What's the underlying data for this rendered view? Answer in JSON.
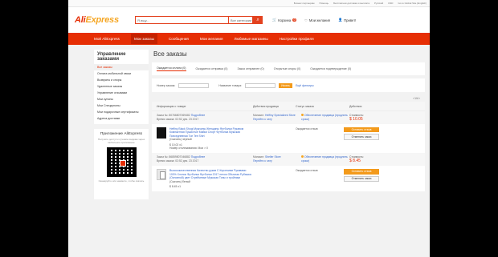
{
  "topbar": {
    "links": [
      "Бизнес партнерам",
      "Помощь",
      "Сохранить",
      "Бесплатная доставка и выплата",
      "Русский",
      "USD",
      "Sell on AliExpress",
      "Go to Global Site (English)"
    ]
  },
  "header": {
    "logo_main": "Ali",
    "logo_sub": "Express",
    "search_placeholder": "Я ищу...",
    "search_category": "Все категории",
    "cart_label": "Корзина",
    "cart_count": "0",
    "wishlist_label": "Мои желания",
    "account_label": "Привет!"
  },
  "nav": {
    "items": [
      "Мой AliExpress",
      "Мои заказы",
      "Сообщения",
      "Мои желания",
      "Любимые магазины",
      "Настройки профиля"
    ]
  },
  "sidebar": {
    "title": "Управление заказами",
    "items": [
      "Все заказы",
      "Оплата мобильной связи",
      "Возвраты и споры",
      "Удаленные заказы",
      "Управление отзывами",
      "Мои купоны",
      "Мои Спецкупоны",
      "Мои подарочные сертификаты",
      "Адреса доставки"
    ],
    "app_title": "Приложение AliExpress",
    "app_text": "Получите доступ к лучшим скидкам через мобильное приложение",
    "app_caption": "Сканируйте или нажмите, чтобы скачать"
  },
  "main": {
    "title": "Все заказы",
    "status_tabs": [
      "Ожидается оплата (0)",
      "Ожидается отправка (0)",
      "Заказ отправлен (0)",
      "Открытые споры (0)",
      "Ожидается подтверждение (0)"
    ],
    "filter_order_label": "Номер заказа:",
    "filter_product_label": "Название товара:",
    "filter_button": "Искать",
    "filter_more": "Ещё фильтры",
    "pager": "1/4",
    "columns": [
      "Информация о товаре",
      "Действия продавца",
      "Статус заказа",
      "Действия"
    ],
    "orders": [
      {
        "order_no": "Заказ №: 80766807069482",
        "detail_link": "Подробнее",
        "order_time": "Время заказа: 02:52 дек. 23 2017",
        "seller_label": "Магазин:",
        "seller": "Heffiny Specialized Store",
        "contact": "Перейти к чату",
        "protection": "Обеспечение продавца (продлить сроки)",
        "amount_label": "Стоимость:",
        "amount": "$ 10.05",
        "product": "Heffiny Black Shogi Мужчины Женщины Футболки Рукавом Компактная Пушистые Майки Спорт Футболка Мужская Повседневная Топ Tee Shirt",
        "product_note": "(Скачать) черный",
        "price": "$ 10.02 x1",
        "tracking": "Номер отслеживания: Мои > 0",
        "status": "Ожидается отзыв",
        "btn_primary": "Оставить отзыв",
        "btn_secondary": "Отменить заказ"
      },
      {
        "order_no": "Заказ №: 86859807046882",
        "detail_link": "Подробнее",
        "order_time": "Время заказа: 02:52 дек. 23 2017",
        "seller_label": "Магазин:",
        "seller": "Sheller Store",
        "contact": "Перейти к чату",
        "protection": "Обеспечение продавца (продлить сроки)",
        "amount_label": "Стоимость:",
        "amount": "$ 8.45",
        "product": "Высококачественная Качество рукав С Короткими Рукавами 100% Хлопок Футболки Футболки 2017 летом Обычная Рубашка (Основной) цвет Стрейчевые Мужская Топы и тройники",
        "product_note": "(Скачать) белый",
        "price": "$ 8.45 x1",
        "status": "Ожидается отзыв",
        "btn_primary": "Оставить отзыв",
        "btn_secondary": "Отменить заказ"
      }
    ]
  }
}
